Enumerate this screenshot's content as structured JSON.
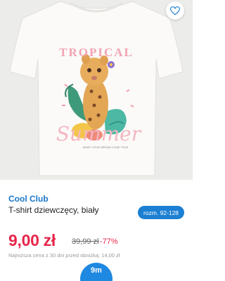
{
  "product": {
    "image": {
      "print_top": "TROPICAL",
      "print_bottom": "Summer",
      "print_small": "MAKE YOUR DREAM COME TRUE"
    },
    "brand": "Cool Club",
    "name": "T-shirt dziewczęcy, biały",
    "size_label": "rozm. 92-128",
    "price": "9,00 zł",
    "old_price": "39,99 zł",
    "discount": "-77%",
    "lowest_price_note": "Najniższa cena z 30 dni przed obniżką: 14,00 zł"
  },
  "badge": {
    "label": "9m"
  },
  "colors": {
    "brand": "#1877c9",
    "price": "#e6264a",
    "accent_blue": "#1c7fd2"
  }
}
